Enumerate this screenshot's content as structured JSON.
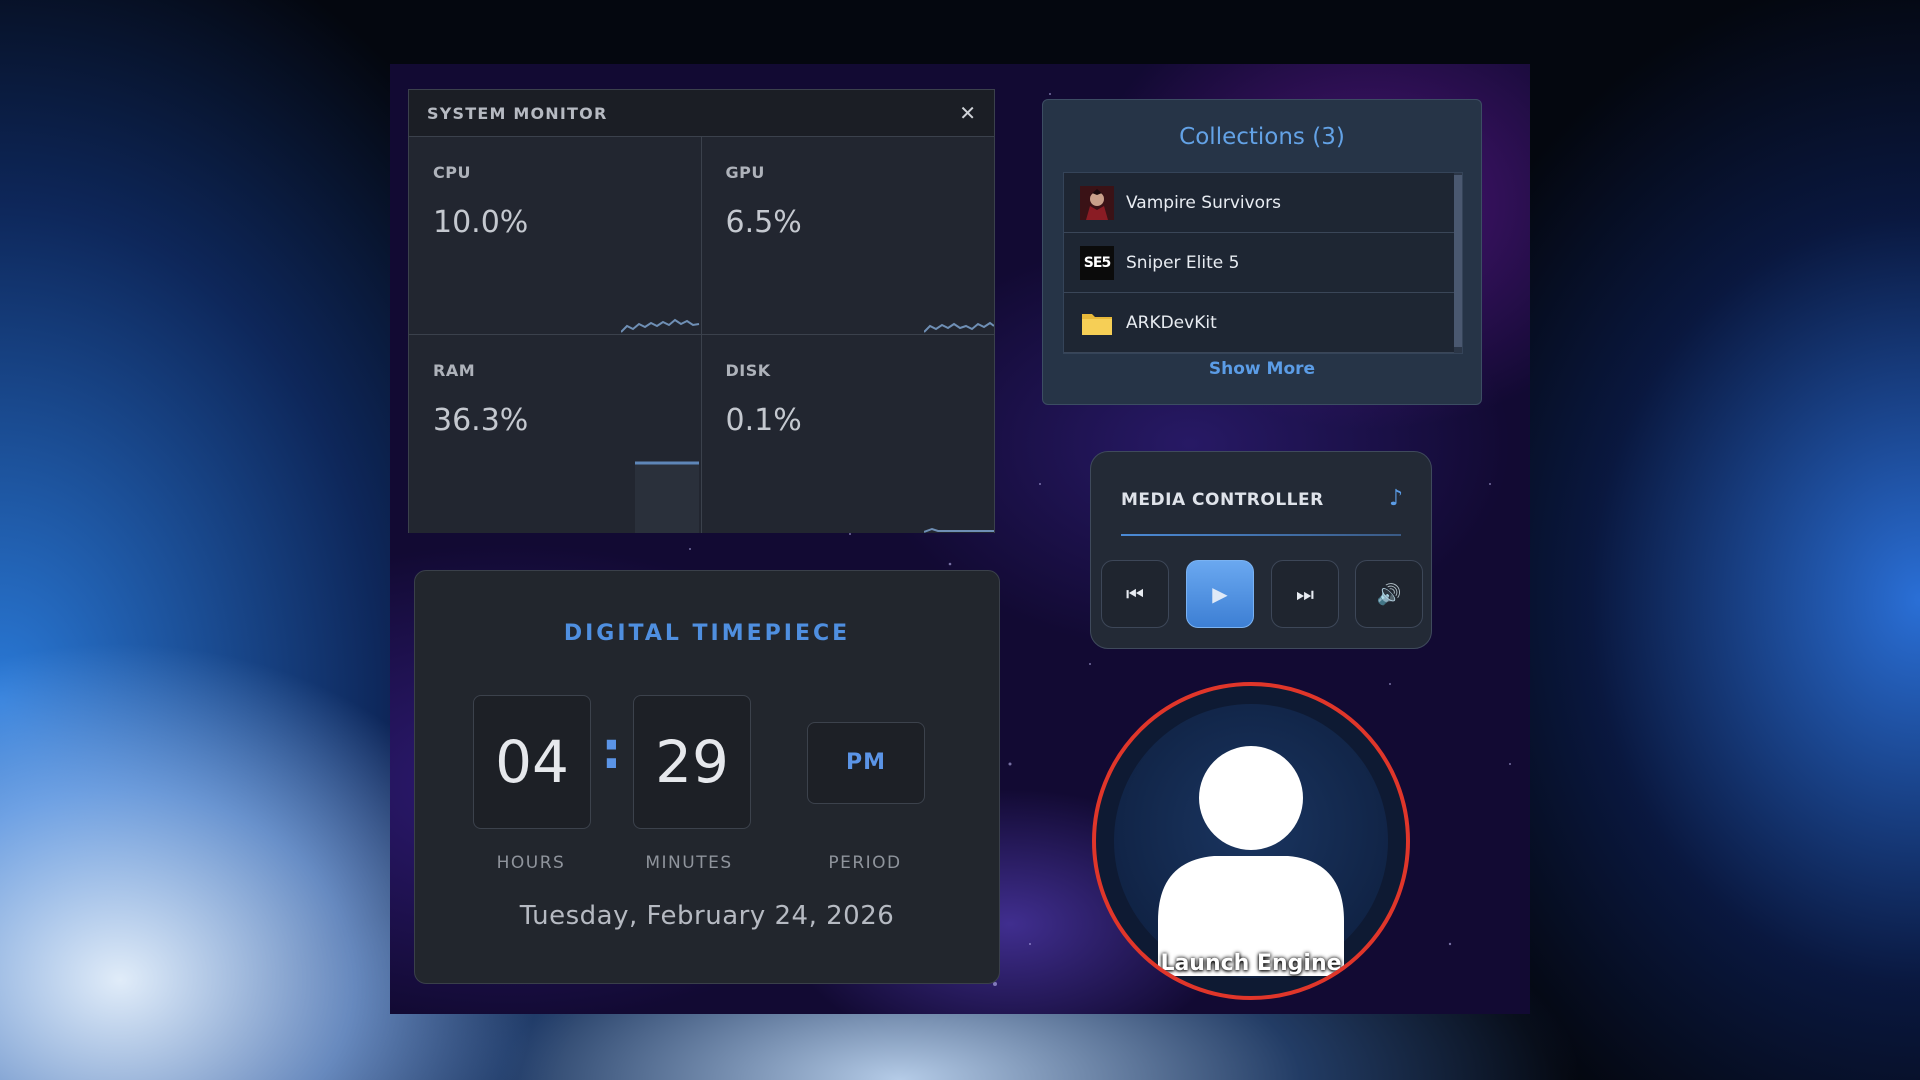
{
  "system_monitor": {
    "title": "SYSTEM MONITOR",
    "close_label": "✕",
    "metrics": [
      {
        "label": "CPU",
        "value": "10.0%"
      },
      {
        "label": "GPU",
        "value": "6.5%"
      },
      {
        "label": "RAM",
        "value": "36.3%"
      },
      {
        "label": "DISK",
        "value": "0.1%"
      }
    ]
  },
  "timepiece": {
    "title": "DIGITAL TIMEPIECE",
    "hours": "04",
    "separator": ":",
    "minutes": "29",
    "period": "PM",
    "hours_label": "HOURS",
    "minutes_label": "MINUTES",
    "period_label": "PERIOD",
    "date": "Tuesday, February 24, 2026"
  },
  "collections": {
    "title": "Collections (3)",
    "items": [
      {
        "name": "Vampire Survivors",
        "icon": "vampire-survivors-icon"
      },
      {
        "name": "Sniper Elite 5",
        "icon": "sniper-elite-5-icon",
        "icon_text": "SE5"
      },
      {
        "name": "ARKDevKit",
        "icon": "folder-icon"
      }
    ],
    "show_more": "Show More"
  },
  "media_controller": {
    "title": "MEDIA CONTROLLER",
    "note_icon": "♪",
    "buttons": {
      "prev": "⏮",
      "play": "▶",
      "next": "⏭",
      "volume": "🔊"
    }
  },
  "launch": {
    "label": "Launch Engine"
  },
  "colors": {
    "accent": "#4f8fe0",
    "launch_ring": "#e0362a"
  }
}
